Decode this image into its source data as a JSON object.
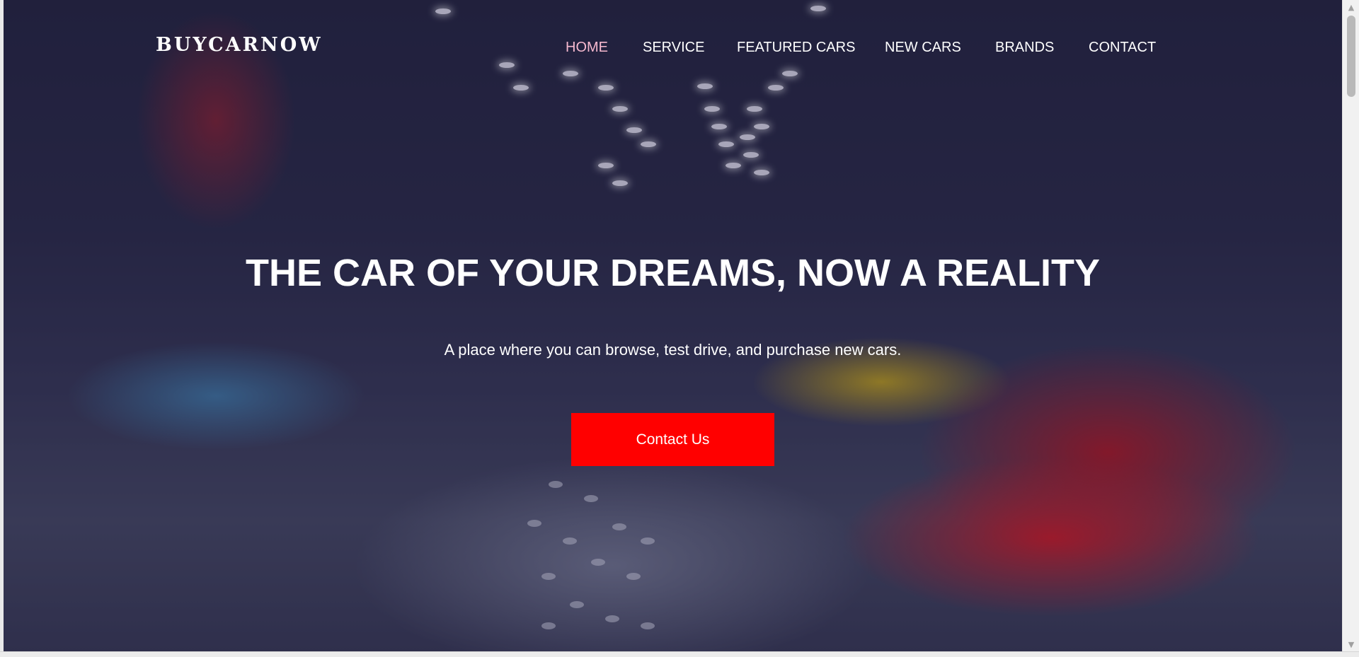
{
  "brand": {
    "logo_text": "BUYCARNOW"
  },
  "nav": {
    "items": [
      {
        "label": "HOME",
        "active": true
      },
      {
        "label": "SERVICE",
        "active": false
      },
      {
        "label": "FEATURED CARS",
        "active": false
      },
      {
        "label": "NEW CARS",
        "active": false
      },
      {
        "label": "BRANDS",
        "active": false
      },
      {
        "label": "CONTACT",
        "active": false
      }
    ]
  },
  "hero": {
    "title": "THE CAR OF YOUR DREAMS, NOW A REALITY",
    "subtitle": "A place where you can browse, test drive, and purchase new cars.",
    "cta_label": "Contact Us",
    "background_image": "car-showroom-photo"
  },
  "scrollbar": {
    "up_icon": "scroll-up-arrow-icon",
    "down_icon": "scroll-down-arrow-icon"
  },
  "colors": {
    "accent": "#ff0000",
    "active_nav": "#f6b9cf",
    "text": "#ffffff",
    "overlay": "#191937"
  }
}
